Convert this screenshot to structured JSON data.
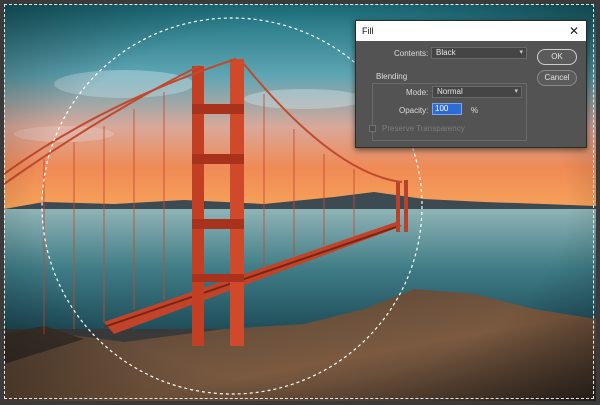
{
  "dialog": {
    "title": "Fill",
    "close_glyph": "✕",
    "contents_label": "Contents:",
    "contents_value": "Black",
    "blending_label": "Blending",
    "mode_label": "Mode:",
    "mode_value": "Normal",
    "opacity_label": "Opacity:",
    "opacity_value": "100",
    "opacity_unit": "%",
    "preserve_label": "Preserve Transparency",
    "preserve_checked": false,
    "ok_label": "OK",
    "cancel_label": "Cancel"
  },
  "icons": {
    "dropdown": "chevron-down-icon",
    "close": "close-icon"
  },
  "colors": {
    "dialog_bg": "#535353",
    "accent": "#2d6bd6"
  }
}
